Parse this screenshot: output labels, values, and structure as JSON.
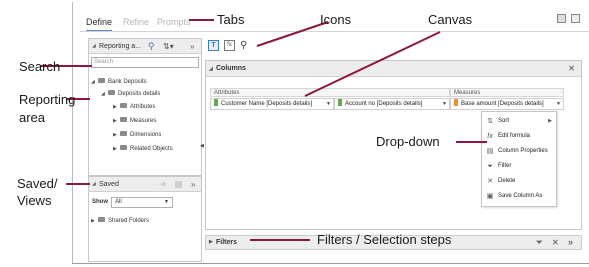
{
  "tabs": [
    {
      "label": "Define",
      "active": true
    },
    {
      "label": "Refine",
      "active": false
    },
    {
      "label": "Prompts",
      "active": false
    }
  ],
  "reporting_panel": {
    "title": "Reporting a...",
    "search_placeholder": "Search",
    "tree": {
      "root": "Bank Deposits",
      "child": "Deposits details",
      "items": [
        "Attributes",
        "Measures",
        "Dimensions",
        "Related Objects"
      ]
    }
  },
  "saved_panel": {
    "title": "Saved",
    "show_label": "Show",
    "show_value": "All",
    "folder": "Shared Folders"
  },
  "canvas": {
    "columns_title": "Columns",
    "group_attributes": "Attributes",
    "group_measures": "Measures",
    "columns": [
      {
        "label": "Customer Name [Deposits details]",
        "color": "#6aa84f"
      },
      {
        "label": "Account no [Deposits details]",
        "color": "#6aa84f"
      },
      {
        "label": "Base amount [Deposits details]",
        "color": "#e69138"
      }
    ],
    "menu": [
      "Sort",
      "Edit formula",
      "Column Properties",
      "Filter",
      "Delete",
      "Save Column As"
    ],
    "filters_title": "Filters"
  },
  "annotations": {
    "tabs": "Tabs",
    "icons": "Icons",
    "canvas": "Canvas",
    "search": "Search",
    "reporting_line1": "Reporting",
    "reporting_line2": "area",
    "dropdown": "Drop-down",
    "saved_line1": "Saved/",
    "saved_line2": "Views",
    "filters": "Filters / Selection steps"
  },
  "colors": {
    "accent": "#5b8fc7",
    "attribute_marker": "#6aa84f",
    "measure_marker": "#e69138",
    "annotation_line": "#8b1a3a"
  }
}
